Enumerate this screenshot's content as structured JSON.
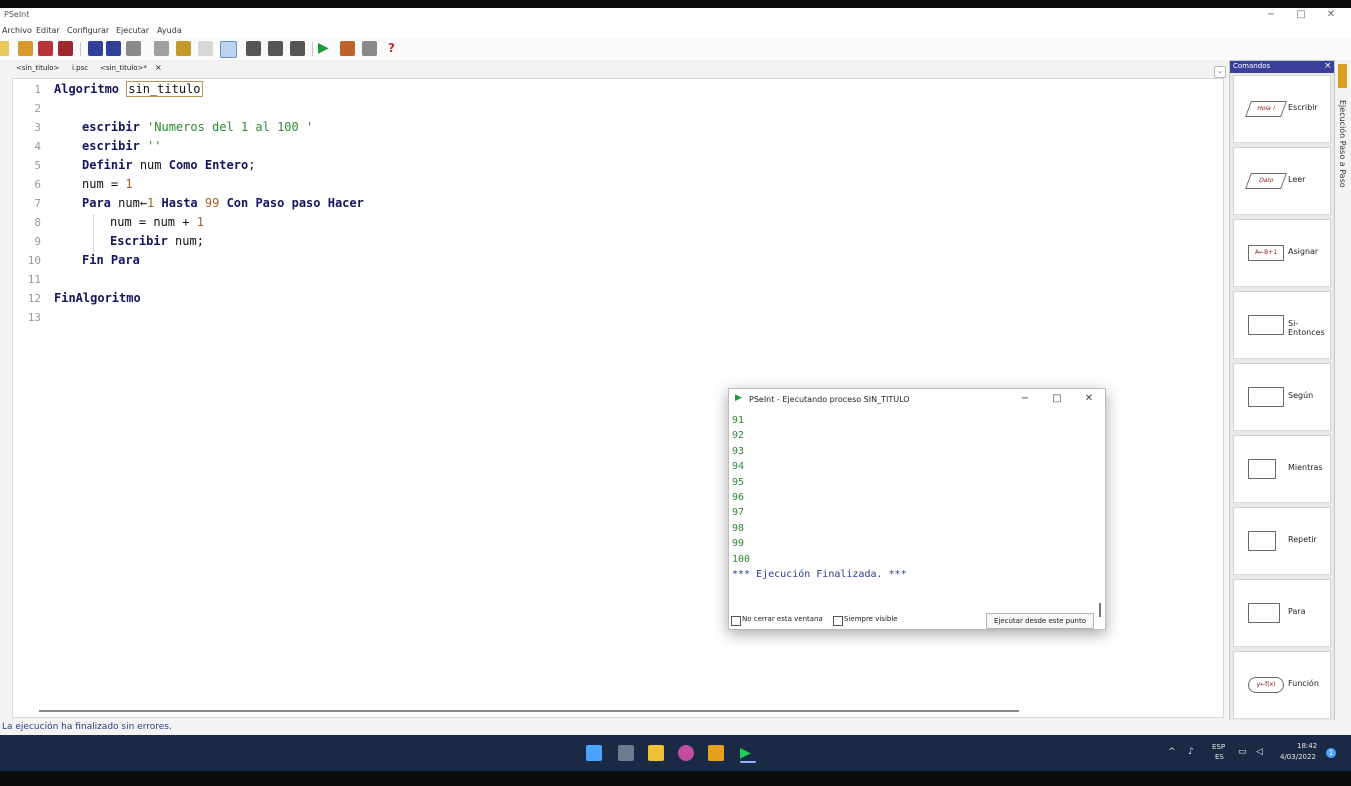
{
  "window": {
    "title": "PSeInt"
  },
  "menu": [
    "Archivo",
    "Editar",
    "Configurar",
    "Ejecutar",
    "Ayuda"
  ],
  "tabs": [
    {
      "label": "<sin_titulo>"
    },
    {
      "label": "i.psc"
    },
    {
      "label": "<sin_titulo>*"
    }
  ],
  "tab_close": "×",
  "editor": {
    "lines": [
      {
        "n": "1"
      },
      {
        "n": "2"
      },
      {
        "n": "3"
      },
      {
        "n": "4"
      },
      {
        "n": "5"
      },
      {
        "n": "6"
      },
      {
        "n": "7"
      },
      {
        "n": "8"
      },
      {
        "n": "9"
      },
      {
        "n": "10"
      },
      {
        "n": "11"
      },
      {
        "n": "12"
      },
      {
        "n": "13"
      }
    ],
    "tokens": {
      "l1_kw": "Algoritmo",
      "l1_name": "sin_titulo",
      "l3_kw": "escribir",
      "l3_str": "'Numeros del 1 al 100 '",
      "l4_kw": "escribir",
      "l4_str": "''",
      "l5_kw1": "Definir",
      "l5_var": "num",
      "l5_kw2": "Como Entero",
      "l5_end": ";",
      "l6_var": "num = ",
      "l6_num": "1",
      "l7_kw1": "Para",
      "l7_var": "num←",
      "l7_num1": "1",
      "l7_kw2": "Hasta",
      "l7_num2": "99",
      "l7_kw3": "Con Paso",
      "l7_kw4": "paso",
      "l7_kw5": "Hacer",
      "l8_var": "num = num + ",
      "l8_num": "1",
      "l9_kw": "Escribir",
      "l9_var": "num;",
      "l10_kw": "Fin Para",
      "l12_kw": "FinAlgoritmo"
    }
  },
  "status": "La ejecución ha finalizado sin errores.",
  "commands": {
    "header": "Comandos",
    "close": "×",
    "items": [
      {
        "label": "Escribir",
        "icon": "escribir-icon",
        "icon_text": "Hola !"
      },
      {
        "label": "Leer",
        "icon": "leer-icon",
        "icon_text": "Dato"
      },
      {
        "label": "Asignar",
        "icon": "asignar-icon",
        "icon_text": "A←B+1"
      },
      {
        "label": "Si-Entonces",
        "icon": "si-entonces-icon",
        "icon_text": ""
      },
      {
        "label": "Según",
        "icon": "segun-icon",
        "icon_text": ""
      },
      {
        "label": "Mientras",
        "icon": "mientras-icon",
        "icon_text": ""
      },
      {
        "label": "Repetir",
        "icon": "repetir-icon",
        "icon_text": ""
      },
      {
        "label": "Para",
        "icon": "para-icon",
        "icon_text": ""
      },
      {
        "label": "Función",
        "icon": "funcion-icon",
        "icon_text": "y←f(x)"
      }
    ]
  },
  "side_panel": {
    "label": "Ejecución Paso a Paso"
  },
  "popup": {
    "title": "PSeInt - Ejecutando proceso SIN_TITULO",
    "output": [
      "91",
      "92",
      "93",
      "94",
      "95",
      "96",
      "97",
      "98",
      "99",
      "100",
      "*** Ejecución Finalizada. ***"
    ],
    "checkbox1": "No cerrar esta ventana",
    "checkbox2": "Siempre visible",
    "run_button": "Ejecutar desde este punto"
  },
  "tray": {
    "lang": "ESP",
    "lang2": "ES",
    "time": "18:42",
    "date": "4/03/2022",
    "badge": "1"
  },
  "colors": {
    "accent": "#3a3f9c",
    "keyword": "#141460",
    "string": "#2e8b2e",
    "number": "#a06020"
  }
}
